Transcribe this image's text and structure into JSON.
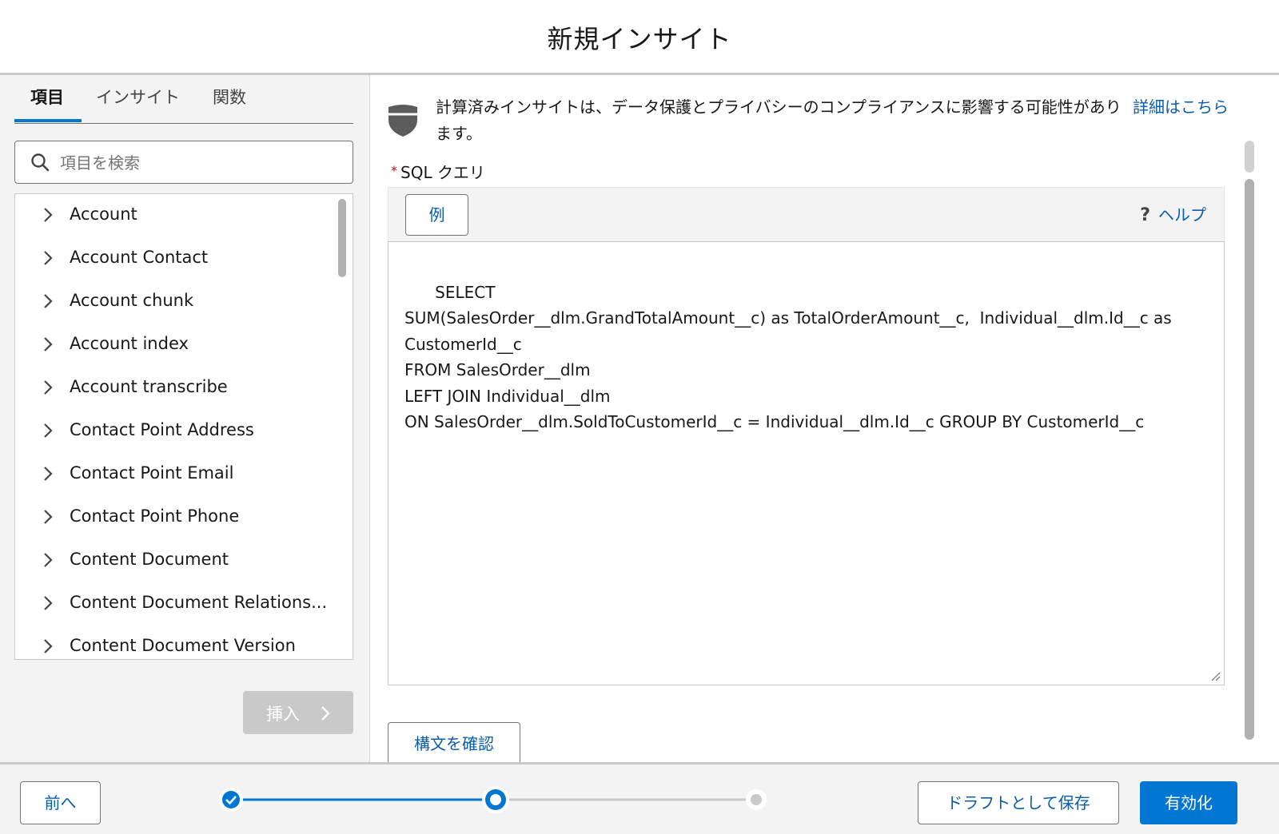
{
  "header": {
    "title": "新規インサイト"
  },
  "left_panel": {
    "tabs": [
      {
        "label": "項目",
        "active": true
      },
      {
        "label": "インサイト",
        "active": false
      },
      {
        "label": "関数",
        "active": false
      }
    ],
    "search": {
      "placeholder": "項目を検索",
      "value": ""
    },
    "items": [
      "Account",
      "Account Contact",
      "Account chunk",
      "Account index",
      "Account transcribe",
      "Contact Point Address",
      "Contact Point Email",
      "Contact Point Phone",
      "Content Document",
      "Content Document Relations...",
      "Content Document Version"
    ],
    "insert_label": "挿入",
    "icons": {
      "search": "search-icon",
      "expand": "chevron-right-icon"
    }
  },
  "right_panel": {
    "notice": {
      "text": "計算済みインサイトは、データ保護とプライバシーのコンプライアンスに影響する可能性があります。",
      "link": "詳細はこちら",
      "icon": "shield-icon"
    },
    "sql": {
      "required_mark": "*",
      "label": "SQL クエリ",
      "example_label": "例",
      "help_mark": "?",
      "help_label": "ヘルプ",
      "query": "SELECT\nSUM(SalesOrder__dlm.GrandTotalAmount__c) as TotalOrderAmount__c,  Individual__dlm.Id__c as CustomerId__c\nFROM SalesOrder__dlm\nLEFT JOIN Individual__dlm\nON SalesOrder__dlm.SoldToCustomerId__c = Individual__dlm.Id__c GROUP BY CustomerId__c"
    },
    "check_syntax_label": "構文を確認"
  },
  "footer": {
    "prev_label": "前へ",
    "progress": {
      "total_steps": 3,
      "current_step": 2,
      "completed_steps": 1
    },
    "draft_label": "ドラフトとして保存",
    "activate_label": "有効化"
  },
  "colors": {
    "brand": "#0176d3",
    "link": "#0b5cab",
    "required": "#ba0517",
    "disabled": "#c9c9c9"
  }
}
